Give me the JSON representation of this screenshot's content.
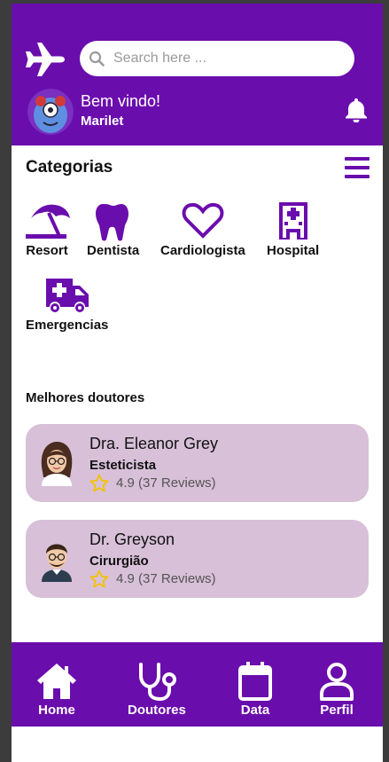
{
  "colors": {
    "primary": "#6a0dad",
    "card": "#d8c0d8",
    "star": "#f2c200",
    "background": "#ffffff"
  },
  "header": {
    "logo_icon": "airplane-icon",
    "search": {
      "placeholder": "Search here ..."
    },
    "greeting": "Bem vindo!",
    "username": "Marilet",
    "notification_icon": "bell-icon"
  },
  "categories": {
    "title": "Categorias",
    "menu_icon": "hamburger-menu-icon",
    "items": [
      {
        "label": "Resort",
        "icon": "beach-umbrella-icon"
      },
      {
        "label": "Dentista",
        "icon": "tooth-icon"
      },
      {
        "label": "Cardiologista",
        "icon": "heart-icon"
      },
      {
        "label": "Hospital",
        "icon": "hospital-icon"
      },
      {
        "label": "Emergencias",
        "icon": "ambulance-icon"
      }
    ]
  },
  "doctors": {
    "title": "Melhores doutores",
    "items": [
      {
        "name": "Dra. Eleanor Grey",
        "specialty": "Esteticista",
        "rating": "4.9 (37 Reviews)"
      },
      {
        "name": "Dr. Greyson",
        "specialty": "Cirurgião",
        "rating": "4.9 (37 Reviews)"
      }
    ]
  },
  "nav": {
    "items": [
      {
        "label": "Home",
        "icon": "home-icon"
      },
      {
        "label": "Doutores",
        "icon": "stethoscope-icon"
      },
      {
        "label": "Data",
        "icon": "calendar-icon"
      },
      {
        "label": "Perfil",
        "icon": "user-icon"
      }
    ]
  }
}
